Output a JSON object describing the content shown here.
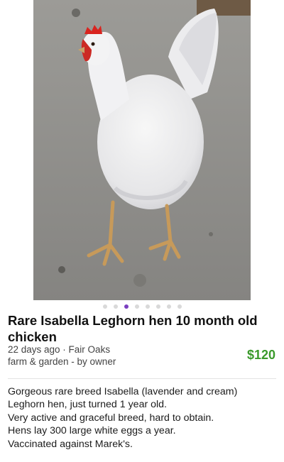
{
  "listing": {
    "title": "Rare Isabella Leghorn hen 10 month old chicken",
    "posted": "22 days ago · Fair Oaks",
    "category": "farm & garden - by owner",
    "price": "$120",
    "photo_count": 8,
    "current_photo": 3,
    "description_lines": [
      "Gorgeous rare breed Isabella (lavender and cream)",
      "Leghorn hen, just turned 1 year old.",
      "Very active and graceful breed, hard to obtain.",
      "Hens lay 300 large white eggs a year.",
      "Vaccinated against Marek's."
    ]
  },
  "colors": {
    "price": "#3a9a2b",
    "active_dot": "#7a3fbf",
    "inactive_dot": "#d9d9d9"
  }
}
